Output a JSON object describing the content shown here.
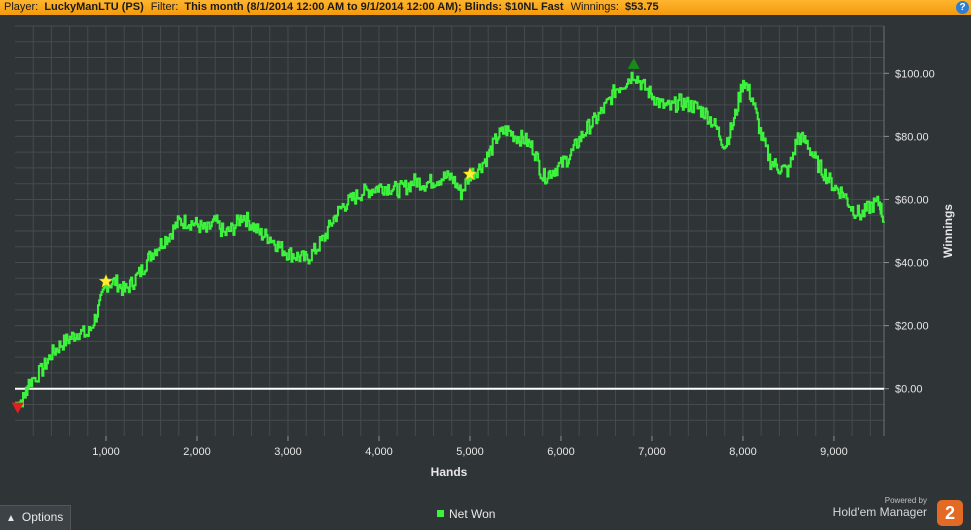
{
  "header": {
    "player_label": "Player:",
    "player_value": "LuckyManLTU (PS)",
    "filter_label": "Filter:",
    "filter_value": "This month (8/1/2014 12:00 AM to 9/1/2014 12:00 AM); Blinds: $10NL Fast",
    "winnings_label": "Winnings:",
    "winnings_value": "$53.75",
    "help_icon": "?"
  },
  "colors": {
    "background": "#2f3437",
    "grid": "#454b4f",
    "line": "#3df23d",
    "zero_line": "#ffffff",
    "header": "#f7a51d"
  },
  "chart_data": {
    "type": "line",
    "xlabel": "Hands",
    "ylabel": "Winnings",
    "xlim": [
      0,
      9550
    ],
    "ylim": [
      -15,
      115
    ],
    "x_ticks": [
      1000,
      2000,
      3000,
      4000,
      5000,
      6000,
      7000,
      8000,
      9000
    ],
    "x_tick_labels": [
      "1,000",
      "2,000",
      "3,000",
      "4,000",
      "5,000",
      "6,000",
      "7,000",
      "8,000",
      "9,000"
    ],
    "y_ticks": [
      0,
      20,
      40,
      60,
      80,
      100
    ],
    "y_tick_labels": [
      "$0.00",
      "$20.00",
      "$40.00",
      "$60.00",
      "$80.00",
      "$100.00"
    ],
    "grid": true,
    "series": [
      {
        "name": "Net Won",
        "color": "#3df23d",
        "x": [
          0,
          100,
          150,
          300,
          400,
          500,
          600,
          700,
          800,
          900,
          1000,
          1100,
          1200,
          1300,
          1400,
          1500,
          1600,
          1700,
          1800,
          1900,
          2000,
          2100,
          2200,
          2300,
          2400,
          2500,
          2600,
          2700,
          2800,
          2900,
          3000,
          3100,
          3200,
          3300,
          3400,
          3500,
          3600,
          3700,
          3800,
          3900,
          4000,
          4100,
          4200,
          4300,
          4400,
          4500,
          4600,
          4700,
          4800,
          4900,
          5000,
          5100,
          5200,
          5300,
          5400,
          5500,
          5600,
          5700,
          5800,
          5900,
          6000,
          6100,
          6200,
          6300,
          6400,
          6500,
          6600,
          6700,
          6800,
          6900,
          7000,
          7100,
          7200,
          7300,
          7400,
          7500,
          7600,
          7700,
          7800,
          7900,
          8000,
          8100,
          8200,
          8300,
          8400,
          8500,
          8600,
          8700,
          8800,
          8900,
          9000,
          9100,
          9200,
          9300,
          9400,
          9500,
          9550
        ],
        "y": [
          -5,
          -3,
          2,
          6,
          11,
          14,
          16,
          18,
          17,
          24,
          33,
          34,
          31,
          34,
          38,
          43,
          46,
          49,
          53,
          53,
          52,
          50,
          53,
          49,
          51,
          55,
          52,
          49,
          48,
          45,
          43,
          42,
          41,
          44,
          48,
          54,
          58,
          60,
          62,
          63,
          64,
          64,
          63,
          64,
          66,
          65,
          66,
          67,
          67,
          62,
          68,
          70,
          74,
          80,
          82,
          80,
          79,
          76,
          67,
          69,
          71,
          74,
          79,
          83,
          86,
          90,
          95,
          97,
          100,
          96,
          93,
          90,
          89,
          91,
          90,
          89,
          87,
          83,
          77,
          85,
          98,
          92,
          80,
          72,
          70,
          69,
          80,
          78,
          72,
          68,
          64,
          62,
          57,
          55,
          58,
          59,
          53
        ]
      }
    ],
    "markers": [
      {
        "type": "min",
        "symbol": "down-triangle",
        "color": "#e02020",
        "x": 30,
        "y": -6
      },
      {
        "type": "star",
        "symbol": "star",
        "color": "#ffee33",
        "x": 1000,
        "y": 34
      },
      {
        "type": "star",
        "symbol": "star",
        "color": "#ffee33",
        "x": 5000,
        "y": 68
      },
      {
        "type": "max",
        "symbol": "up-triangle",
        "color": "#1a8a1a",
        "x": 6800,
        "y": 103
      }
    ]
  },
  "legend": {
    "label": "Net Won"
  },
  "options": {
    "label": "Options"
  },
  "branding": {
    "powered_by": "Powered by",
    "name": "Hold'em Manager",
    "logo_text": "2"
  }
}
